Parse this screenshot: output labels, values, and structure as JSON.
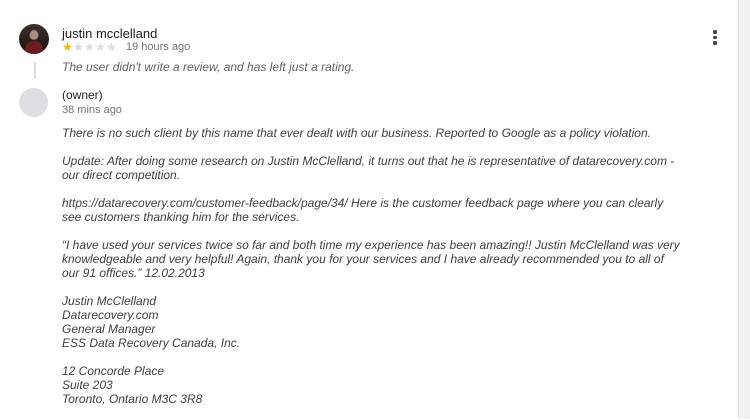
{
  "review": {
    "reviewer_name": "justin mcclelland",
    "rating": 1,
    "rating_max": 5,
    "time": "19 hours ago",
    "text": "The user didn't write a review, and has left just a rating."
  },
  "owner_response": {
    "label": "(owner)",
    "time": "38 mins ago",
    "paragraphs": [
      "There is no such client by this name that ever dealt with our business. Reported to Google as a policy violation.",
      "Update: After doing some research on Justin McClelland, it turns out that he is representative of datarecovery.com - our direct competition.",
      "https://datarecovery.com/customer-feedback/page/34/ Here is the customer feedback page where you can clearly see customers thanking him for the services.",
      "“I have used your services twice so far and both time my experience has been amazing!! Justin McClelland was very knowledgeable and very helpful! Again, thank you for your services and I have already recommended you to all of our 91 offices.” 12.02.2013"
    ],
    "signature": [
      "Justin McClelland",
      "Datarecovery.com",
      "General Manager",
      "ESS Data Recovery Canada, Inc."
    ],
    "address": [
      "12 Concorde Place",
      "Suite 203",
      "Toronto, Ontario M3C 3R8"
    ]
  },
  "icons": {
    "more": "more-vert-icon",
    "star": "star-icon"
  },
  "colors": {
    "star_on": "#f6b600",
    "star_off": "#dadce0"
  }
}
